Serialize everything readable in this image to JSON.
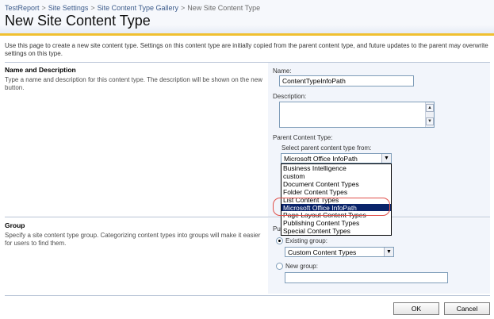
{
  "breadcrumb": {
    "items": [
      "TestReport",
      "Site Settings",
      "Site Content Type Gallery"
    ],
    "current": "New Site Content Type",
    "separator": ">"
  },
  "page": {
    "title": "New Site Content Type",
    "intro": "Use this page to create a new site content type. Settings on this content type are initially copied from the parent content type, and future updates to the parent may overwrite settings on this type."
  },
  "name_section": {
    "title": "Name and Description",
    "description": "Type a name and description for this content type. The description will be shown on the new button.",
    "name_label": "Name:",
    "name_value": "ContentTypeInfoPath",
    "description_label": "Description:",
    "description_value": "",
    "parent_label": "Parent Content Type:",
    "select_from_label": "Select parent content type from:",
    "selected_parent": "Microsoft Office InfoPath",
    "options": [
      "Business Intelligence",
      "custom",
      "Document Content Types",
      "Folder Content Types",
      "List Content Types",
      "Microsoft Office InfoPath",
      "Page Layout Content Types",
      "Publishing Content Types",
      "Special Content Types"
    ],
    "highlighted_option": "Microsoft Office InfoPath"
  },
  "group_section": {
    "title": "Group",
    "description": "Specify a site content type group. Categorizing content types into groups will make it easier for users to find them.",
    "put_label_visible": "Pu",
    "existing_group_label": "Existing group:",
    "existing_group_value": "Custom Content Types",
    "existing_selected": true,
    "new_group_label": "New group:",
    "new_group_value": ""
  },
  "actions": {
    "ok": "OK",
    "cancel": "Cancel"
  },
  "colors": {
    "accent_bar": "#f0c030",
    "selection": "#0a246a",
    "annotation_ring": "#e0504a",
    "panel_bg": "#f2f5fb"
  }
}
